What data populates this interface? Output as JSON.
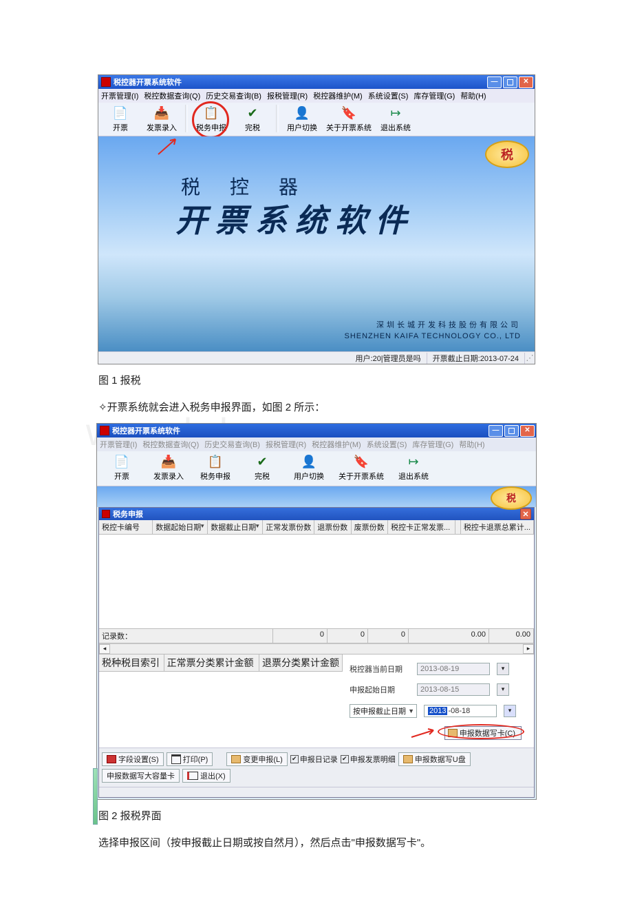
{
  "captions": {
    "fig1": "图 1 报税",
    "fig2": "图 2 报税界面"
  },
  "body": {
    "line1_prefix": "✧",
    "line1": "开票系统就会进入税务申报界面，如图 2 所示：",
    "line2": "选择申报区间（按申报截止日期或按自然月），然后点击\"申报数据写卡\"。"
  },
  "watermark": "www.bdocx.com",
  "app": {
    "title": "税控器开票系统软件",
    "menus": {
      "m1": "开票管理(I)",
      "m2": "税控数据查询(Q)",
      "m3": "历史交易查询(B)",
      "m4": "报税管理(R)",
      "m5": "税控器维护(M)",
      "m6": "系统设置(S)",
      "m7": "库存管理(G)",
      "m8": "帮助(H)"
    },
    "tools": {
      "t1": "开票",
      "t2": "发票录入",
      "t3": "税务申报",
      "t4": "完税",
      "t5": "用户切换",
      "t6": "关于开票系统",
      "t7": "退出系统"
    },
    "brand_small": "税 控 器",
    "brand_big": "开票系统软件",
    "company_cn": "深圳长城开发科技股份有限公司",
    "company_en": "SHENZHEN KAIFA TECHNOLOGY CO., LTD",
    "status_user": "用户:20|管理员是吗",
    "status_deadline": "开票截止日期:2013-07-24"
  },
  "sub": {
    "title": "税务申报",
    "cols": {
      "c1": "税控卡编号",
      "c2": "数据起始日期",
      "c3": "数据截止日期",
      "c4": "正常发票份数",
      "c5": "退票份数",
      "c6": "废票份数",
      "c7": "税控卡正常发票...",
      "c8": "税控卡退票总累计..."
    },
    "footer": {
      "label": "记录数：",
      "v1": "0",
      "v2": "0",
      "v3": "0",
      "v4": "0.00",
      "v5": "0.00"
    },
    "lower_cols": {
      "lc1": "税种税目索引",
      "lc2": "正常票分类累计金额",
      "lc3": "退票分类累计金额"
    },
    "form": {
      "f1_label": "税控器当前日期",
      "f1_value": "2013-08-19",
      "f2_label": "申报起始日期",
      "f2_value": "2013-08-15",
      "f3_select": "按申报截止日期",
      "f3_value_hl": "2013",
      "f3_value_rest": "-08-18"
    },
    "write_card": "申报数据写卡(C)",
    "btnbar": {
      "b_field": "字段设置(S)",
      "b_print": "打印(P)",
      "b_change": "变更申报(L)",
      "chk_log": "申报日记录",
      "chk_detail": "申报发票明细",
      "b_udisk": "申报数据写U盘",
      "b_bigcard": "申报数据写大容量卡",
      "b_exit": "退出(X)"
    }
  }
}
